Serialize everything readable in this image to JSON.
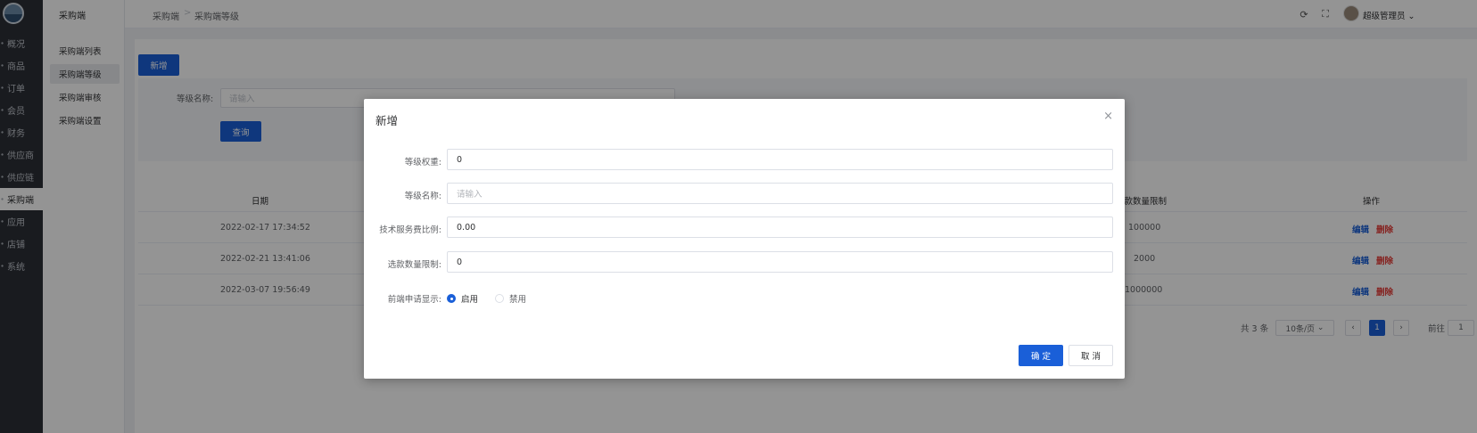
{
  "nav": {
    "items": [
      {
        "label": "概况"
      },
      {
        "label": "商品"
      },
      {
        "label": "订单"
      },
      {
        "label": "会员"
      },
      {
        "label": "财务"
      },
      {
        "label": "供应商"
      },
      {
        "label": "供应链"
      },
      {
        "label": "采购端"
      },
      {
        "label": "应用"
      },
      {
        "label": "店铺"
      },
      {
        "label": "系统"
      }
    ],
    "active_index": 7
  },
  "subnav": {
    "title": "采购端",
    "items": [
      {
        "label": "采购端列表"
      },
      {
        "label": "采购端等级"
      },
      {
        "label": "采购端审核"
      },
      {
        "label": "采购端设置"
      }
    ],
    "active_index": 1
  },
  "header": {
    "breadcrumb": [
      "采购端",
      "采购端等级"
    ],
    "breadcrumb_sep": ">",
    "user": "超级管理员",
    "refresh_icon": "refresh-icon",
    "fullscreen_icon": "fullscreen-icon"
  },
  "toolbar": {
    "add_label": "新增"
  },
  "filter": {
    "name_label": "等级名称:",
    "name_placeholder": "请输入",
    "search_label": "查询"
  },
  "table": {
    "columns": {
      "date": "日期",
      "limit": "选款数量限制",
      "actions": "操作"
    },
    "rows": [
      {
        "date": "2022-02-17 17:34:52",
        "limit": "100000"
      },
      {
        "date": "2022-02-21 13:41:06",
        "limit": "2000"
      },
      {
        "date": "2022-03-07 19:56:49",
        "limit": "1000000"
      }
    ],
    "edit_label": "编辑",
    "delete_label": "删除"
  },
  "pagination": {
    "total": "共 3 条",
    "page_size": "10条/页",
    "current_page": "1",
    "goto_label": "前往",
    "goto_value": "1"
  },
  "dialog": {
    "title": "新增",
    "fields": {
      "weight": {
        "label": "等级权重:",
        "value": "0"
      },
      "name": {
        "label": "等级名称:",
        "placeholder": "请输入"
      },
      "fee": {
        "label": "技术服务费比例:",
        "value": "0.00"
      },
      "limit": {
        "label": "选款数量限制:",
        "value": "0"
      },
      "display": {
        "label": "前端申请显示:",
        "options": [
          "启用",
          "禁用"
        ],
        "selected": "启用"
      }
    },
    "confirm_label": "确 定",
    "cancel_label": "取 消"
  },
  "colors": {
    "primary": "#1a5fd8",
    "danger": "#e53935",
    "nav_bg": "#2b2f36"
  }
}
